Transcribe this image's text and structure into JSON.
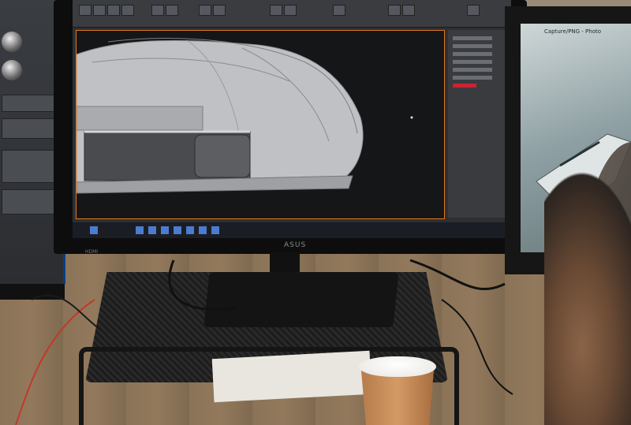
{
  "main_monitor": {
    "brand": "ASUS",
    "model": "HDMI"
  },
  "right_monitor": {
    "window_title": "Capture/PNG - Photo"
  },
  "colors": {
    "viewport_frame": "#e07a1c",
    "left_monitor_edge": "#0a3c8c",
    "taskbar": "#1b1d24"
  }
}
